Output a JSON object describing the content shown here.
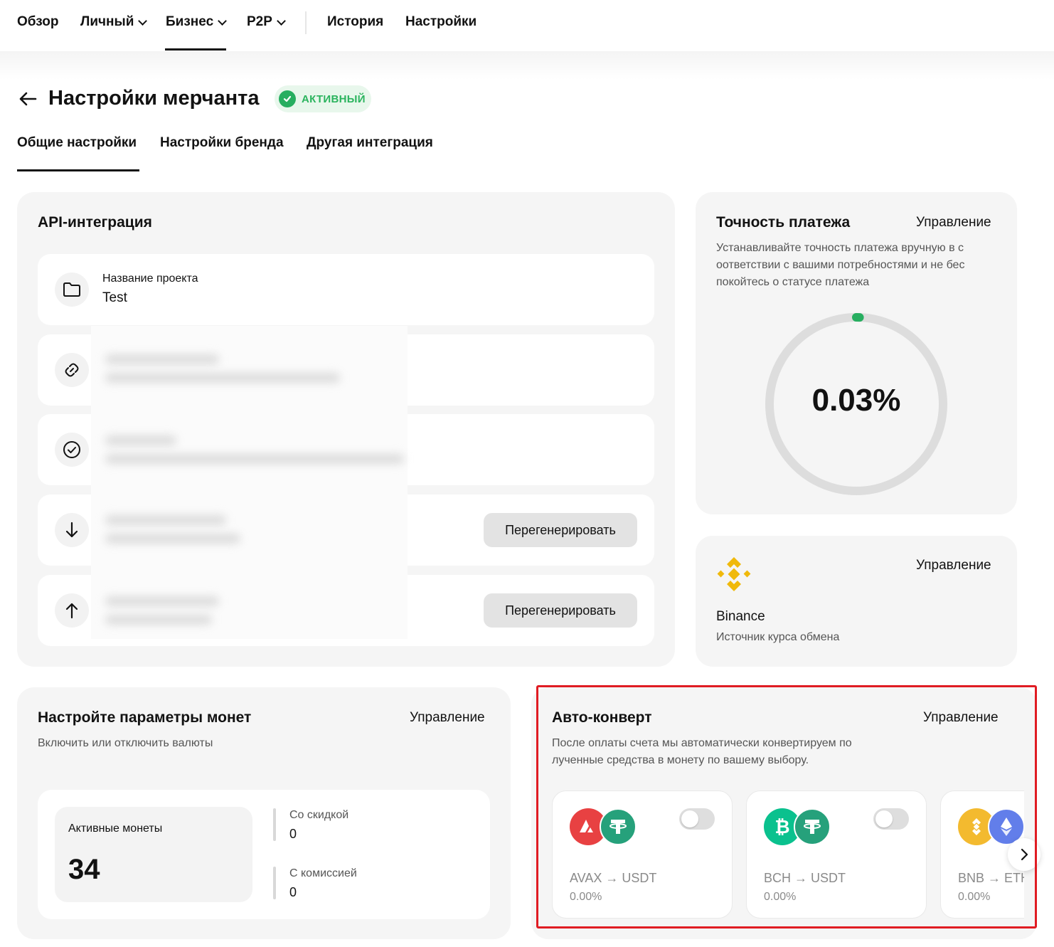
{
  "nav": {
    "overview": "Обзор",
    "personal": "Личный",
    "business": "Бизнес",
    "p2p": "P2P",
    "history": "История",
    "settings": "Настройки"
  },
  "header": {
    "title": "Настройки мерчанта",
    "status": "АКТИВНЫЙ"
  },
  "tabs": [
    "Общие настройки",
    "Настройки бренда",
    "Другая интеграция"
  ],
  "api": {
    "title": "API-интеграция",
    "project_label": "Название проекта",
    "project_value": "Test",
    "regenerate": "Перегенерировать"
  },
  "accuracy": {
    "title": "Точность платежа",
    "manage": "Управление",
    "desc_lines": [
      "Устанавливайте точность платежа вручную в с",
      "оответствии с вашими потребностями и не бес",
      "покойтесь о статусе платежа"
    ],
    "value": "0.03%",
    "value_fraction": 0.0003
  },
  "rate_source": {
    "manage": "Управление",
    "name": "Binance",
    "desc": "Источник курса обмена"
  },
  "coins": {
    "title": "Настройте параметры монет",
    "manage": "Управление",
    "desc": "Включить или отключить валюты",
    "active_label": "Активные монеты",
    "active_value": "34",
    "discount_label": "Со скидкой",
    "discount_value": "0",
    "fee_label": "С комиссией",
    "fee_value": "0"
  },
  "auto_convert": {
    "title": "Авто-конверт",
    "manage": "Управление",
    "desc_lines": [
      "После оплаты счета мы автоматически конвертируем по",
      "лученные средства в монету по вашему выбору."
    ],
    "pairs": [
      {
        "pair": "AVAX → USDT",
        "percent": "0.00%",
        "enabled": false,
        "from_color": "#e84142",
        "to_color": "#26a17b"
      },
      {
        "pair": "BCH → USDT",
        "percent": "0.00%",
        "enabled": false,
        "from_color": "#0ac18e",
        "to_color": "#26a17b"
      },
      {
        "pair": "BNB → ETH",
        "percent": "0.00%",
        "enabled": false,
        "from_color": "#f3ba2f",
        "to_color": "#627eea"
      }
    ]
  },
  "colors": {
    "accent_green": "#27ae60",
    "highlight_red": "#e01c23",
    "binance_yellow": "#f0b90b"
  }
}
